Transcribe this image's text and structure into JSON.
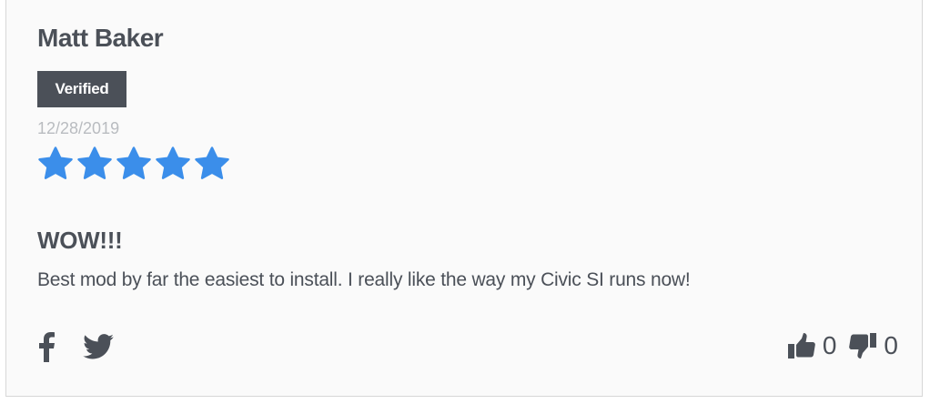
{
  "review": {
    "reviewer_name": "Matt Baker",
    "badge": "Verified",
    "date": "12/28/2019",
    "rating": 5,
    "rating_max": 5,
    "title": "WOW!!!",
    "body": "Best mod by far the easiest to install. I really like the way my Civic SI runs now!"
  },
  "share": {
    "icons": [
      "facebook-icon",
      "twitter-icon"
    ]
  },
  "votes": {
    "helpful_count": "0",
    "not_helpful_count": "0",
    "icons": [
      "thumbs-up-icon",
      "thumbs-down-icon"
    ]
  },
  "colors": {
    "text": "#4b5058",
    "badge_bg": "#4b5058",
    "date": "#b9bcc0",
    "star": "#3b8eea",
    "card_bg": "#fafafa",
    "border": "#d7d7d7"
  }
}
